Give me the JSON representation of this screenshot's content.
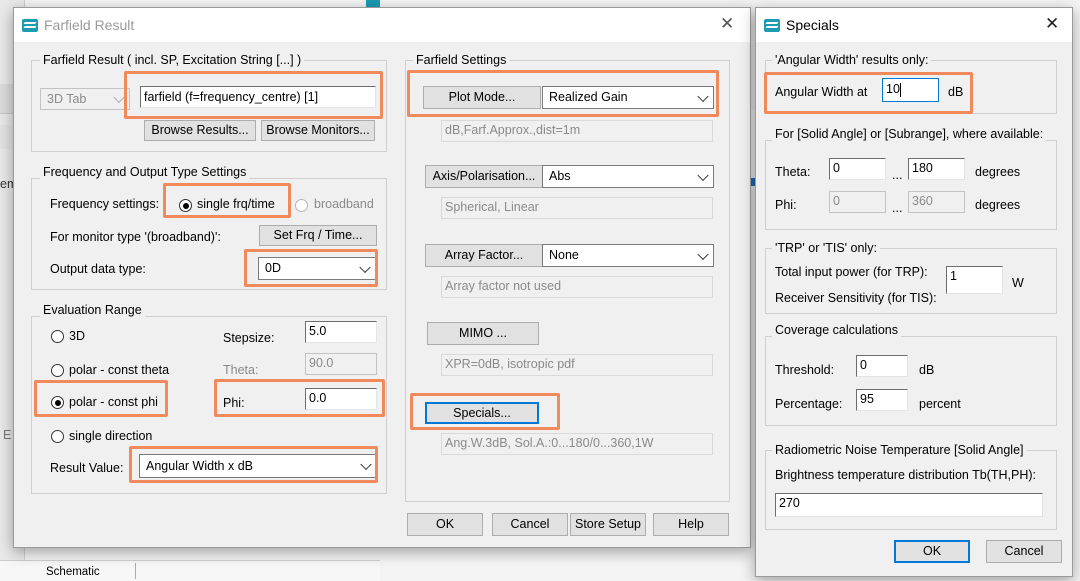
{
  "background": {
    "status_label": "Schematic",
    "edge_fragments": [
      "em",
      "E"
    ]
  },
  "farfield_dialog": {
    "title": "Farfield Result",
    "result_group": {
      "legend": "Farfield Result ( incl. SP, Excitation String [...] )",
      "tab_combo": "3D Tab",
      "result_name": "farfield (f=frequency_centre) [1]",
      "browse_results": "Browse Results...",
      "browse_monitors": "Browse Monitors..."
    },
    "frequency_group": {
      "legend": "Frequency and Output Type Settings",
      "freq_label": "Frequency settings:",
      "single_label": "single frq/time",
      "broadband_label": "broadband",
      "monitor_label": "For monitor type '(broadband)':",
      "set_frq_button": "Set Frq / Time...",
      "output_label": "Output data type:",
      "output_value": "0D"
    },
    "evaluation_group": {
      "legend": "Evaluation Range",
      "opt_3d": "3D",
      "opt_polar_theta": "polar - const theta",
      "opt_polar_phi": "polar - const phi",
      "opt_single": "single direction",
      "stepsize_label": "Stepsize:",
      "stepsize_value": "5.0",
      "theta_label": "Theta:",
      "theta_value": "90.0",
      "phi_label": "Phi:",
      "phi_value": "0.0",
      "result_value_label": "Result Value:",
      "result_value": "Angular Width x dB"
    },
    "farfield_settings": {
      "legend": "Farfield Settings",
      "plot_mode_button": "Plot Mode...",
      "plot_mode_value": "Realized Gain",
      "plot_mode_info": "dB,Farf.Approx.,dist=1m",
      "axis_button": "Axis/Polarisation...",
      "axis_value": "Abs",
      "axis_info": "Spherical, Linear",
      "array_button": "Array Factor...",
      "array_value": "None",
      "array_info": "Array factor not used",
      "mimo_button": "MIMO ...",
      "mimo_info": "XPR=0dB, isotropic pdf",
      "specials_button": "Specials...",
      "specials_info": "Ang.W.3dB, Sol.A.:0...180/0...360,1W"
    },
    "footer": {
      "ok": "OK",
      "cancel": "Cancel",
      "store_setup": "Store Setup",
      "help": "Help"
    }
  },
  "specials_dialog": {
    "title": "Specials",
    "angular_group": {
      "legend": "'Angular Width' results only:",
      "label": "Angular Width at",
      "value": "10",
      "unit": "dB"
    },
    "solid_angle_group": {
      "legend": "For [Solid Angle] or [Subrange], where available:",
      "theta_label": "Theta:",
      "theta_from": "0",
      "theta_to": "180",
      "phi_label": "Phi:",
      "phi_from": "0",
      "phi_to": "360",
      "ellipsis": "...",
      "unit": "degrees"
    },
    "trp_group": {
      "legend": "'TRP' or 'TIS' only:",
      "power_label": "Total input power (for TRP):",
      "sensitivity_label": "Receiver Sensitivity (for TIS):",
      "value": "1",
      "unit": "W"
    },
    "coverage_group": {
      "legend": "Coverage calculations",
      "threshold_label": "Threshold:",
      "threshold_value": "0",
      "threshold_unit": "dB",
      "percentage_label": "Percentage:",
      "percentage_value": "95",
      "percentage_unit": "percent"
    },
    "noise_group": {
      "legend": "Radiometric Noise Temperature [Solid Angle]",
      "label": "Brightness temperature distribution Tb(TH,PH):",
      "value": "270"
    },
    "footer": {
      "ok": "OK",
      "cancel": "Cancel"
    }
  },
  "colors": {
    "highlight": "#f08a5d",
    "focus": "#0078d7",
    "accent": "#1d9bb1"
  }
}
